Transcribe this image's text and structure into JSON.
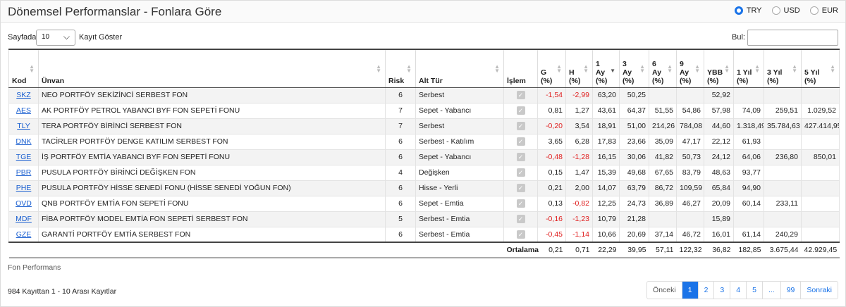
{
  "header": {
    "title": "Dönemsel Performanslar - Fonlara Göre"
  },
  "currency": {
    "options": [
      "TRY",
      "USD",
      "EUR"
    ],
    "selected": "TRY"
  },
  "controls": {
    "length_prefix": "Sayfada",
    "length_value": "10",
    "length_suffix": "Kayıt Göster",
    "search_label": "Bul:",
    "search_value": ""
  },
  "table": {
    "headers": [
      "Kod",
      "Ünvan",
      "Risk",
      "Alt Tür",
      "İşlem",
      "G\n(%)",
      "H\n(%)",
      "1\nAy\n(%)",
      "3\nAy\n(%)",
      "6\nAy\n(%)",
      "9\nAy\n(%)",
      "YBB\n(%)",
      "1 Yıl\n(%)",
      "3 Yıl\n(%)",
      "5 Yıl\n(%)"
    ],
    "rows": [
      [
        "SKZ",
        "NEO PORTFÖY SEKİZİNCİ SERBEST FON",
        "6",
        "Serbest",
        "-1,54",
        "-2,99",
        "63,20",
        "50,25",
        "",
        "",
        "52,92",
        "",
        "",
        ""
      ],
      [
        "AES",
        "AK PORTFÖY PETROL YABANCI BYF FON SEPETİ FONU",
        "7",
        "Sepet - Yabancı",
        "0,81",
        "1,27",
        "43,61",
        "64,37",
        "51,55",
        "54,86",
        "57,98",
        "74,09",
        "259,51",
        "1.029,52"
      ],
      [
        "TLY",
        "TERA PORTFÖY BİRİNCİ SERBEST FON",
        "7",
        "Serbest",
        "-0,20",
        "3,54",
        "18,91",
        "51,00",
        "214,26",
        "784,08",
        "44,60",
        "1.318,49",
        "35.784,63",
        "427.414,95"
      ],
      [
        "DNK",
        "TACİRLER PORTFÖY DENGE KATILIM SERBEST FON",
        "6",
        "Serbest - Katılım",
        "3,65",
        "6,28",
        "17,83",
        "23,66",
        "35,09",
        "47,17",
        "22,12",
        "61,93",
        "",
        ""
      ],
      [
        "TGE",
        "İŞ PORTFÖY EMTİA YABANCI BYF FON SEPETİ FONU",
        "6",
        "Sepet - Yabancı",
        "-0,48",
        "-1,28",
        "16,15",
        "30,06",
        "41,82",
        "50,73",
        "24,12",
        "64,06",
        "236,80",
        "850,01"
      ],
      [
        "PBR",
        "PUSULA PORTFÖY BİRİNCİ DEĞİŞKEN FON",
        "4",
        "Değişken",
        "0,15",
        "1,47",
        "15,39",
        "49,68",
        "67,65",
        "83,79",
        "48,63",
        "93,77",
        "",
        ""
      ],
      [
        "PHE",
        "PUSULA PORTFÖY HİSSE SENEDİ FONU (HİSSE SENEDİ YOĞUN FON)",
        "6",
        "Hisse - Yerli",
        "0,21",
        "2,00",
        "14,07",
        "63,79",
        "86,72",
        "109,59",
        "65,84",
        "94,90",
        "",
        ""
      ],
      [
        "OVD",
        "QNB PORTFÖY EMTİA FON SEPETİ FONU",
        "6",
        "Sepet - Emtia",
        "0,13",
        "-0,82",
        "12,25",
        "24,73",
        "36,89",
        "46,27",
        "20,09",
        "60,14",
        "233,11",
        ""
      ],
      [
        "MDF",
        "FİBA PORTFÖY MODEL EMTİA FON SEPETİ SERBEST FON",
        "5",
        "Serbest - Emtia",
        "-0,16",
        "-1,23",
        "10,79",
        "21,28",
        "",
        "",
        "15,89",
        "",
        "",
        ""
      ],
      [
        "GZE",
        "GARANTİ PORTFÖY EMTİA SERBEST FON",
        "6",
        "Serbest - Emtia",
        "-0,45",
        "-1,14",
        "10,66",
        "20,69",
        "37,14",
        "46,72",
        "16,01",
        "61,14",
        "240,29",
        ""
      ]
    ],
    "footer_label": "Ortalama",
    "footer_values": [
      "0,21",
      "0,71",
      "22,29",
      "39,95",
      "57,11",
      "122,32",
      "36,82",
      "182,85",
      "3.675,44",
      "42.929,45"
    ]
  },
  "caption": "Fon Performans",
  "info": "984 Kayıttan 1 - 10 Arası Kayıtlar",
  "pager": [
    "Önceki",
    "1",
    "2",
    "3",
    "4",
    "5",
    "...",
    "99",
    "Sonraki"
  ],
  "pager_active": "1",
  "colors": {
    "accent": "#1a73e8",
    "negative": "#e02020",
    "link": "#1a5fd0"
  }
}
